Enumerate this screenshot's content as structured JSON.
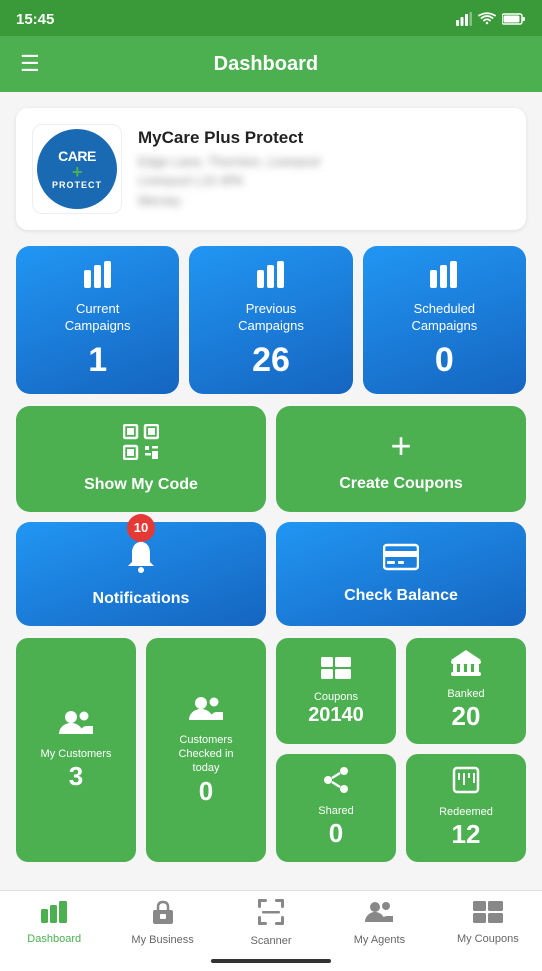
{
  "statusBar": {
    "time": "15:45",
    "signal": "📶",
    "wifi": "📶",
    "battery": "🔋"
  },
  "header": {
    "title": "Dashboard",
    "menuIcon": "☰"
  },
  "profile": {
    "name": "MyCare Plus Protect",
    "addressLine1": "Edge Lane, Thornton, Liverpool",
    "addressLine2": "Liverpool L10 4PA",
    "addressLine3": "Mersey"
  },
  "campaigns": [
    {
      "label": "Current\nCampaigns",
      "count": "1"
    },
    {
      "label": "Previous\nCampaigns",
      "count": "26"
    },
    {
      "label": "Scheduled\nCampaigns",
      "count": "0"
    }
  ],
  "actions": [
    {
      "id": "show-my-code",
      "label": "Show My Code",
      "icon": "qr"
    },
    {
      "id": "create-coupons",
      "label": "Create Coupons",
      "icon": "plus"
    },
    {
      "id": "notifications",
      "label": "Notifications",
      "icon": "bell",
      "badge": "10"
    },
    {
      "id": "check-balance",
      "label": "Check Balance",
      "icon": "card"
    }
  ],
  "stats": {
    "myCustomers": {
      "label": "My Customers",
      "count": "3"
    },
    "checkedIn": {
      "label": "Customers Checked in today",
      "count": "0"
    },
    "coupons": {
      "label": "Coupons",
      "count": "20140"
    },
    "banked": {
      "label": "Banked",
      "count": "20"
    },
    "shared": {
      "label": "Shared",
      "count": "0"
    },
    "redeemed": {
      "label": "Redeemed",
      "count": "12"
    }
  },
  "bottomNav": [
    {
      "id": "dashboard",
      "label": "Dashboard",
      "active": true
    },
    {
      "id": "my-business",
      "label": "My Business",
      "active": false
    },
    {
      "id": "scanner",
      "label": "Scanner",
      "active": false
    },
    {
      "id": "my-agents",
      "label": "My Agents",
      "active": false
    },
    {
      "id": "my-coupons",
      "label": "My Coupons",
      "active": false
    }
  ]
}
